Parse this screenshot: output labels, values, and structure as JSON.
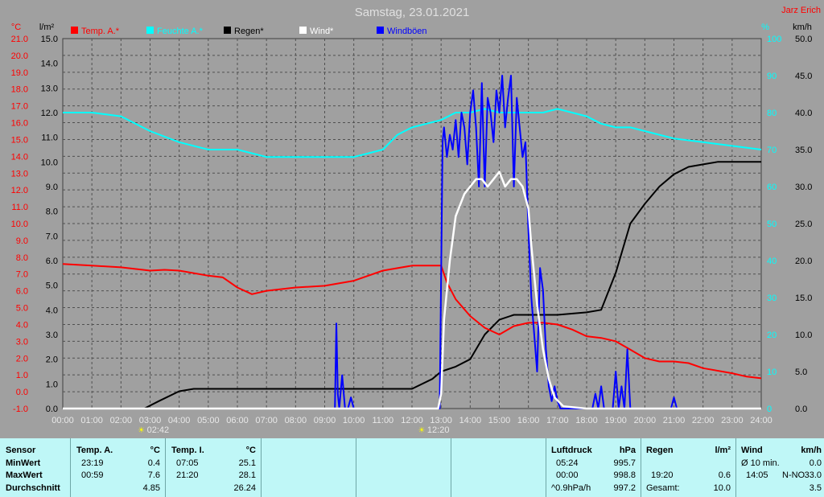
{
  "title": "Samstag, 23.01.2021",
  "author": "Jarz Erich",
  "units": {
    "left1": "°C",
    "left2": "l/m²",
    "right1": "%",
    "right2": "km/h"
  },
  "colors": {
    "bg": "#a0a0a0",
    "temp": "#ff0000",
    "humidity": "#00ffff",
    "rain": "#000000",
    "wind": "#ffffff",
    "gust": "#0000ff",
    "axisRed": "#ff0000"
  },
  "events": [
    {
      "label": "02:42",
      "t": 2.7
    },
    {
      "label": "12:20",
      "t": 12.33
    }
  ],
  "chart_data": {
    "type": "line",
    "x_ticks": [
      "00:00",
      "01:00",
      "02:00",
      "03:00",
      "04:00",
      "05:00",
      "06:00",
      "07:00",
      "08:00",
      "09:00",
      "10:00",
      "11:00",
      "12:00",
      "13:00",
      "14:00",
      "15:00",
      "16:00",
      "17:00",
      "18:00",
      "19:00",
      "20:00",
      "21:00",
      "22:00",
      "23:00",
      "24:00"
    ],
    "axes": {
      "temp": {
        "label": "°C",
        "ticks": [
          "-1.0",
          "0.0",
          "1.0",
          "2.0",
          "3.0",
          "4.0",
          "5.0",
          "6.0",
          "7.0",
          "8.0",
          "9.0",
          "10.0",
          "11.0",
          "12.0",
          "13.0",
          "14.0",
          "15.0",
          "16.0",
          "17.0",
          "18.0",
          "19.0",
          "20.0",
          "21.0"
        ],
        "range": [
          -1,
          21
        ]
      },
      "rain": {
        "label": "l/m²",
        "ticks": [
          "0.0",
          "1.0",
          "2.0",
          "3.0",
          "4.0",
          "5.0",
          "6.0",
          "7.0",
          "8.0",
          "9.0",
          "10.0",
          "11.0",
          "12.0",
          "13.0",
          "14.0",
          "15.0"
        ],
        "range": [
          0,
          15
        ]
      },
      "humidity": {
        "label": "%",
        "ticks": [
          "0",
          "10",
          "20",
          "30",
          "40",
          "50",
          "60",
          "70",
          "80",
          "90",
          "100"
        ],
        "range": [
          0,
          100
        ]
      },
      "wind": {
        "label": "km/h",
        "ticks": [
          "0.0",
          "5.0",
          "10.0",
          "15.0",
          "20.0",
          "25.0",
          "30.0",
          "35.0",
          "40.0",
          "45.0",
          "50.0"
        ],
        "range": [
          0,
          50
        ]
      }
    },
    "series": [
      {
        "name": "Temp. A.*",
        "axis": "temp",
        "color": "#ff0000",
        "t": [
          0,
          1,
          2,
          3,
          3.5,
          4,
          5,
          5.5,
          6,
          6.5,
          7,
          8,
          9,
          10,
          11,
          12,
          12.5,
          13,
          13.2,
          13.5,
          14,
          14.5,
          15,
          15.5,
          16,
          16.5,
          17,
          17.5,
          18,
          18.5,
          19,
          19.5,
          20,
          20.5,
          21,
          21.5,
          22,
          23,
          23.5,
          24
        ],
        "values": [
          7.6,
          7.5,
          7.4,
          7.2,
          7.25,
          7.2,
          6.9,
          6.8,
          6.2,
          5.8,
          6.0,
          6.2,
          6.3,
          6.6,
          7.2,
          7.5,
          7.5,
          7.5,
          6.5,
          5.5,
          4.5,
          3.8,
          3.4,
          3.9,
          4.1,
          4.1,
          4.0,
          3.7,
          3.3,
          3.2,
          3.0,
          2.5,
          2.0,
          1.8,
          1.8,
          1.7,
          1.4,
          1.1,
          0.9,
          0.8
        ]
      },
      {
        "name": "Feuchte A.*",
        "axis": "humidity",
        "color": "#00ffff",
        "t": [
          0,
          1,
          2,
          3,
          4,
          5,
          6,
          7,
          8,
          9,
          10,
          10.5,
          11,
          11.5,
          12,
          12.5,
          13,
          13.5,
          14,
          14.5,
          15,
          15.5,
          16,
          16.5,
          17,
          17.5,
          18,
          18.5,
          19,
          19.5,
          20,
          20.5,
          21,
          22,
          23,
          24
        ],
        "values": [
          80,
          80,
          79,
          75,
          72,
          70,
          70,
          68,
          68,
          68,
          68,
          69,
          70,
          74,
          76,
          77,
          78,
          80,
          80,
          81,
          80,
          80,
          80,
          80,
          81,
          80,
          79,
          77,
          76,
          76,
          75,
          74,
          73,
          72,
          71,
          70
        ]
      },
      {
        "name": "Regen*",
        "axis": "rain",
        "color": "#000000",
        "t": [
          0,
          2.8,
          3.3,
          4,
          4.5,
          5,
          6,
          7,
          8,
          9,
          10,
          11,
          12,
          12.7,
          13,
          13.5,
          14,
          14.5,
          15,
          15.5,
          16,
          17,
          18,
          18.5,
          19,
          19.5,
          20,
          20.5,
          21,
          21.5,
          22,
          22.5,
          23,
          24
        ],
        "values": [
          0,
          0,
          0.3,
          0.7,
          0.8,
          0.8,
          0.8,
          0.8,
          0.8,
          0.8,
          0.8,
          0.8,
          0.8,
          1.2,
          1.5,
          1.7,
          2.0,
          3.0,
          3.6,
          3.8,
          3.8,
          3.8,
          3.9,
          4.0,
          5.5,
          7.5,
          8.3,
          9.0,
          9.5,
          9.8,
          9.9,
          10.0,
          10.0,
          10.0
        ]
      },
      {
        "name": "Wind*",
        "axis": "wind",
        "color": "#ffffff",
        "t": [
          0,
          12.9,
          13.0,
          13.1,
          13.3,
          13.5,
          13.8,
          14.0,
          14.2,
          14.4,
          14.6,
          14.8,
          15.0,
          15.2,
          15.4,
          15.6,
          15.8,
          16.0,
          16.1,
          16.3,
          16.5,
          16.7,
          16.9,
          17.2,
          18,
          24
        ],
        "values": [
          0,
          0,
          2,
          12,
          20,
          26,
          29,
          30,
          31,
          31,
          30,
          31,
          32,
          30,
          31,
          31,
          30,
          27,
          22,
          14,
          8,
          4,
          1.5,
          0.3,
          0,
          0
        ]
      },
      {
        "name": "Windböen",
        "axis": "wind",
        "color": "#0000ff",
        "t": [
          0,
          9.35,
          9.4,
          9.45,
          9.5,
          9.6,
          9.7,
          9.8,
          9.9,
          10.0,
          10.1,
          12.95,
          13.0,
          13.05,
          13.1,
          13.2,
          13.3,
          13.4,
          13.5,
          13.6,
          13.7,
          13.8,
          13.9,
          14.0,
          14.1,
          14.2,
          14.3,
          14.4,
          14.5,
          14.6,
          14.7,
          14.8,
          14.9,
          15.0,
          15.1,
          15.2,
          15.3,
          15.4,
          15.5,
          15.6,
          15.7,
          15.8,
          15.9,
          16.0,
          16.1,
          16.2,
          16.3,
          16.4,
          16.5,
          16.6,
          16.7,
          16.8,
          16.9,
          17.0,
          17.1,
          17.2,
          17.3,
          18.2,
          18.3,
          18.4,
          18.5,
          18.6,
          18.9,
          19.0,
          19.1,
          19.2,
          19.3,
          19.4,
          19.5,
          20.9,
          21.0,
          21.1,
          24
        ],
        "values": [
          0,
          0,
          11.5,
          2,
          0,
          4.5,
          0,
          0,
          1.5,
          0,
          0,
          0,
          18,
          36,
          38,
          34,
          37,
          35,
          39,
          34,
          40,
          38,
          33,
          40,
          43,
          38,
          30,
          44,
          30,
          42,
          40,
          36,
          43,
          40,
          45,
          38,
          42,
          45,
          30,
          42,
          38,
          34,
          36,
          24,
          15,
          10,
          5,
          19,
          16,
          8,
          3,
          1,
          3,
          1,
          0,
          0,
          0,
          0,
          2,
          0,
          3,
          0,
          0,
          5,
          0,
          3,
          0,
          8,
          0,
          0,
          1.5,
          0,
          0
        ]
      }
    ],
    "legend": [
      "Temp. A.*",
      "Feuchte A.*",
      "Regen*",
      "Wind*",
      "Windböen"
    ]
  },
  "table": {
    "sensor": {
      "header": "Sensor",
      "rows": [
        "MinWert",
        "MaxWert",
        "Durchschnitt"
      ]
    },
    "tempA": {
      "header": "Temp. A.",
      "unit": "°C",
      "rows": [
        [
          "23:19",
          "0.4"
        ],
        [
          "00:59",
          "7.6"
        ],
        [
          "",
          "4.85"
        ]
      ]
    },
    "tempI": {
      "header": "Temp. I.",
      "unit": "°C",
      "rows": [
        [
          "07:05",
          "25.1"
        ],
        [
          "21:20",
          "28.1"
        ],
        [
          "",
          "26.24"
        ]
      ]
    },
    "pressure": {
      "header": "Luftdruck",
      "unit": "hPa",
      "rows": [
        [
          "05:24",
          "995.7"
        ],
        [
          "00:00",
          "998.8"
        ],
        [
          "^0.9hPa/h",
          "997.2"
        ]
      ]
    },
    "rain": {
      "header": "Regen",
      "unit": "l/m²",
      "rows": [
        [
          "",
          ""
        ],
        [
          "19:20",
          "0.6"
        ],
        [
          "Gesamt:",
          "10.0"
        ]
      ]
    },
    "wind": {
      "header": "Wind",
      "unit": "km/h",
      "rows": [
        [
          "Ø 10 min.",
          "",
          "0.0"
        ],
        [
          "14:05",
          "N-NO",
          "33.0"
        ],
        [
          "",
          "",
          "3.5"
        ]
      ]
    }
  }
}
